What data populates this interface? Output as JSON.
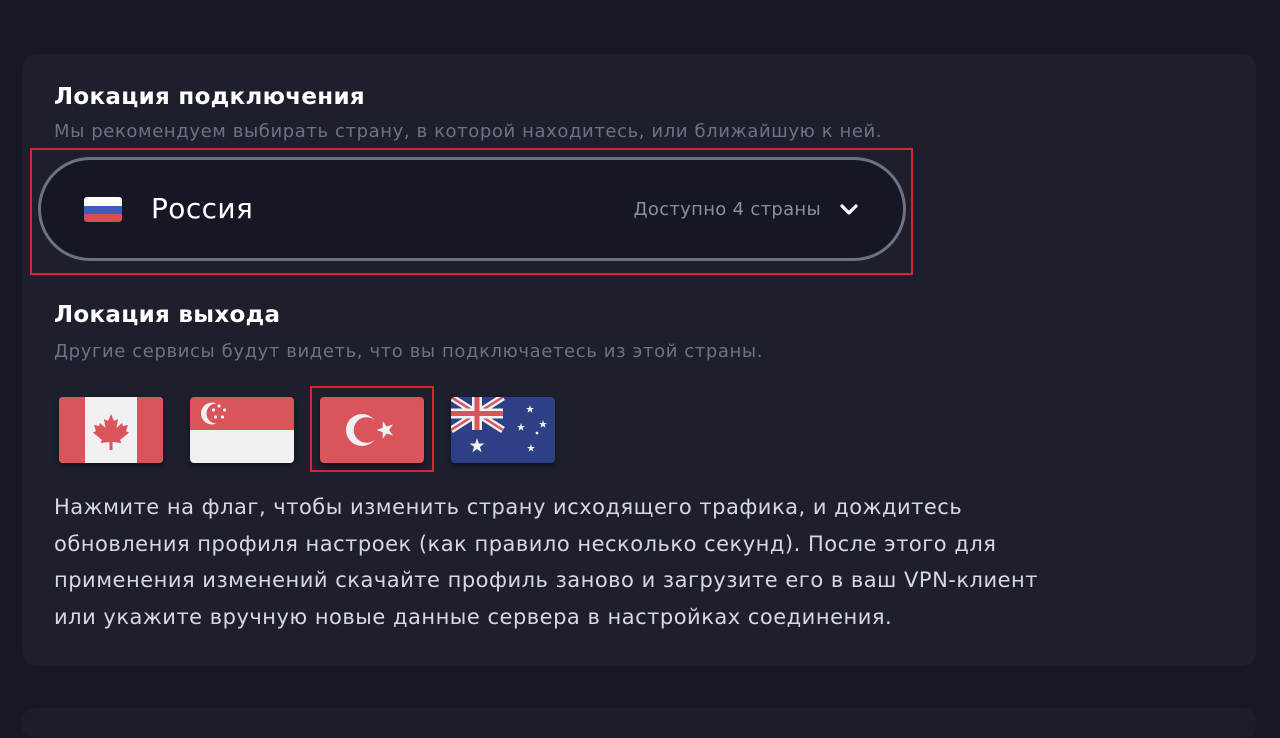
{
  "connection": {
    "title": "Локация подключения",
    "subtitle": "Мы рекомендуем выбирать страну, в которой находитесь, или ближайшую к ней.",
    "selected_country": "Россия",
    "selected_flag_icon": "russia-flag-icon",
    "available_text": "Доступно 4 страны",
    "dropdown_icon": "chevron-down-icon"
  },
  "exit": {
    "title": "Локация выхода",
    "subtitle": "Другие сервисы будут видеть, что вы подключаетесь из этой страны.",
    "flags": [
      {
        "icon": "canada-flag-icon",
        "selected": false
      },
      {
        "icon": "singapore-flag-icon",
        "selected": false
      },
      {
        "icon": "turkey-flag-icon",
        "selected": true
      },
      {
        "icon": "australia-flag-icon",
        "selected": false
      }
    ],
    "info_text": "Нажмите на флаг, чтобы изменить страну исходящего трафика, и дождитесь\nобновления профиля настроек (как правило несколько секунд). После этого для\nприменения изменений скачайте профиль заново и загрузите его в ваш VPN-клиент\nили укажите вручную новые данные сервера в настройках соединения."
  },
  "colors": {
    "background": "#161923",
    "card": "#1d202c",
    "highlight": "#d7262f",
    "flag_red": "#d9545b"
  }
}
